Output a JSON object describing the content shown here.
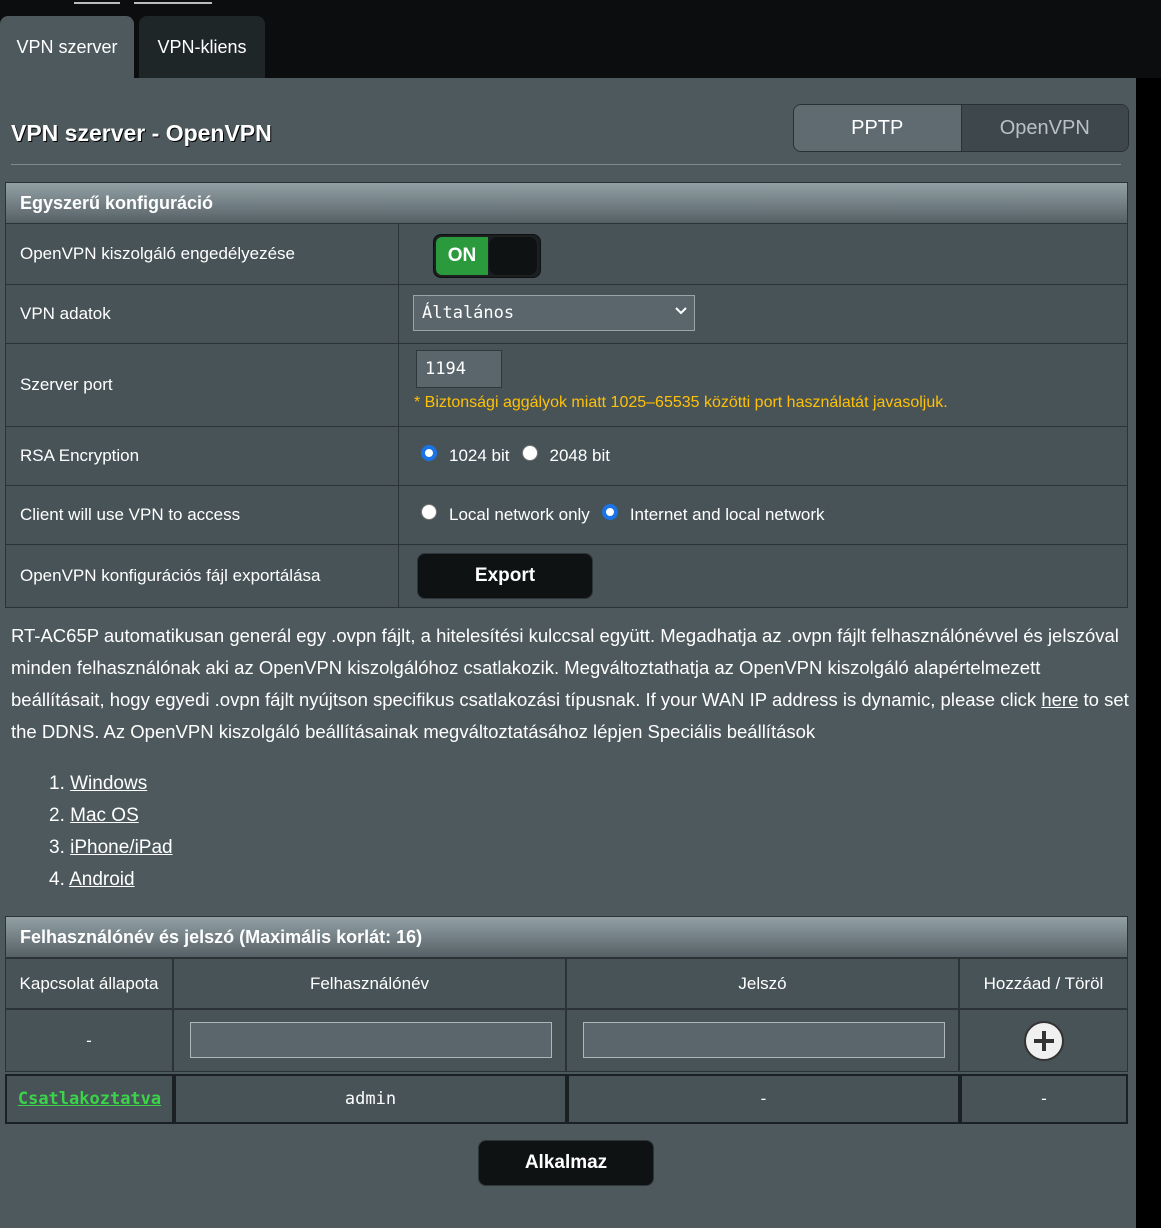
{
  "tabs": [
    "VPN szerver",
    "VPN-kliens"
  ],
  "page_title": "VPN szerver - OpenVPN",
  "protocol_switch": [
    "PPTP",
    "OpenVPN"
  ],
  "basic_config": {
    "title": "Egyszerű konfiguráció",
    "enable_label": "OpenVPN kiszolgáló engedélyezése",
    "enable_state": "ON",
    "vpn_data_label": "VPN adatok",
    "vpn_data_value": "Általános",
    "port_label": "Szerver port",
    "port_value": "1194",
    "port_hint": "* Biztonsági aggályok miatt 1025–65535 közötti port használatát javasoljuk.",
    "rsa_label": "RSA Encryption",
    "rsa_options": [
      "1024 bit",
      "2048 bit"
    ],
    "rsa_selected": "1024 bit",
    "access_label": "Client will use VPN to access",
    "access_options": [
      "Local network only",
      "Internet and local network"
    ],
    "access_selected": "Internet and local network",
    "export_label": "OpenVPN konfigurációs fájl exportálása",
    "export_button": "Export"
  },
  "description": {
    "part1": "RT-AC65P automatikusan generál egy .ovpn fájlt, a hitelesítési kulccsal együtt. Megadhatja az .ovpn fájlt felhasználónévvel és jelszóval minden felhasználónak aki az OpenVPN kiszolgálóhoz csatlakozik. Megváltoztathatja az OpenVPN kiszolgáló alapértelmezett beállításait, hogy egyedi .ovpn fájlt nyújtson specifikus csatlakozási típusnak. If your WAN IP address is dynamic, please click ",
    "link": "here",
    "part2": " to set the DDNS. Az OpenVPN kiszolgáló beállításainak megváltoztatásához lépjen Speciális beállítások"
  },
  "os_links": [
    "Windows",
    "Mac OS",
    "iPhone/iPad",
    "Android"
  ],
  "user_table": {
    "title": "Felhasználónév és jelszó (Maximális korlát: 16)",
    "headers": [
      "Kapcsolat állapota",
      "Felhasználónév",
      "Jelszó",
      "Hozzáad / Töröl"
    ],
    "new_row_status": "-",
    "rows": [
      {
        "status": "Csatlakoztatva",
        "username": "admin",
        "password": "-",
        "action": "-"
      }
    ]
  },
  "apply_button": "Alkalmaz",
  "colors": {
    "background": "#4d595d",
    "toggle_on": "#2a9a3c",
    "hint": "#ffc107",
    "connected": "#3ad34a"
  }
}
